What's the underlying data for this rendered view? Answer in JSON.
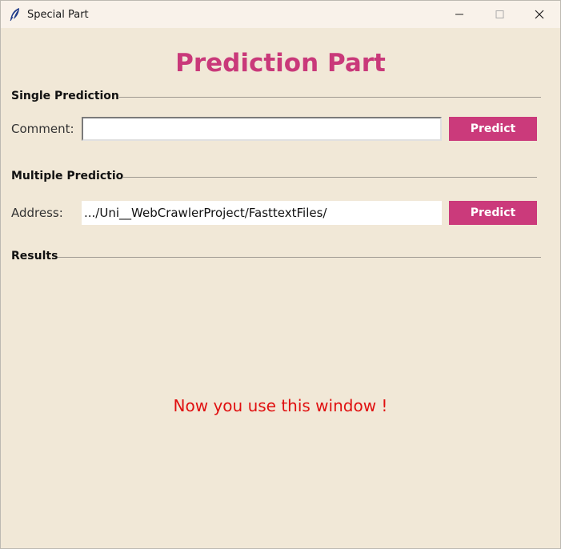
{
  "window": {
    "title": "Special Part",
    "controls": [
      "minimize-icon",
      "maximize-icon",
      "close-icon"
    ]
  },
  "main": {
    "title": "Prediction Part",
    "single": {
      "section_label": "Single Prediction",
      "field_label": "Comment:",
      "input_value": "",
      "button_label": "Predict"
    },
    "multiple": {
      "section_label": "Multiple Predictio",
      "field_label": "Address:",
      "input_value": ".../Uni__WebCrawlerProject/FasttextFiles/",
      "button_label": "Predict"
    },
    "results": {
      "section_label": "Results",
      "message": "Now you use this window !"
    }
  },
  "colors": {
    "background": "#f1e8d7",
    "accent": "#cb3a7b",
    "title": "#c9397a",
    "message": "#e01010"
  }
}
